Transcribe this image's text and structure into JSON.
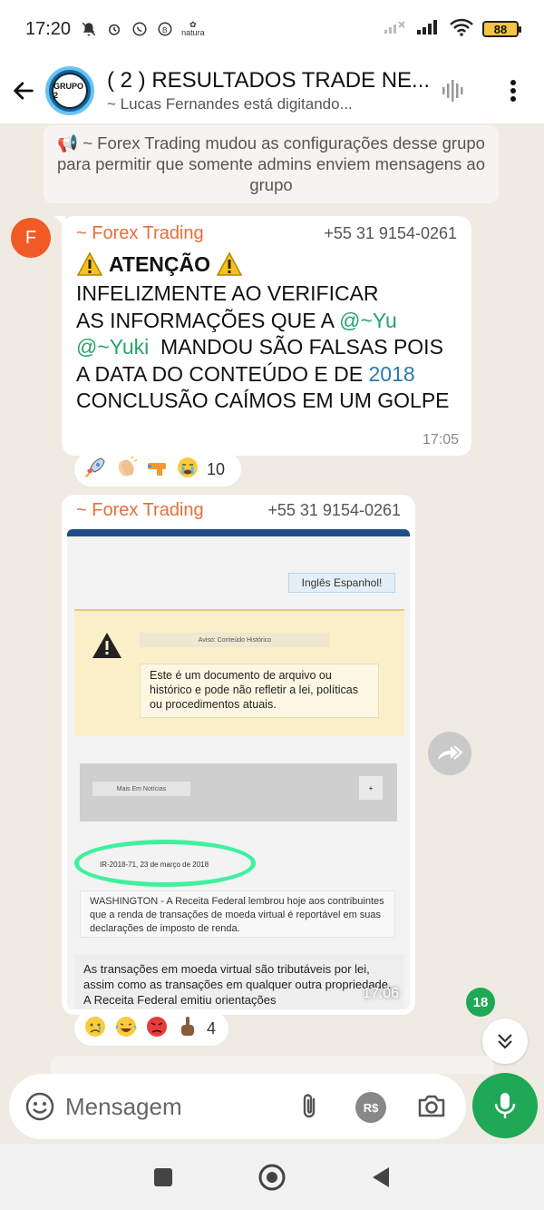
{
  "status_bar": {
    "time": "17:20",
    "natura_label": "natura",
    "battery": "88"
  },
  "header": {
    "avatar_label": "GRUPO 2",
    "title": "( 2 ) RESULTADOS TRADE NE...",
    "subtitle": "~ Lucas Fernandes está digitando..."
  },
  "system_message": "📢 ~ Forex Trading mudou as configurações desse grupo para permitir que somente admins enviem mensagens ao grupo",
  "message1": {
    "avatar_letter": "F",
    "sender": "~ Forex Trading",
    "phone": "+55 31 9154-0261",
    "heading": "ATENÇÃO",
    "line1": "INFELIZMENTE AO VERIFICAR",
    "line2_pre": "AS INFORMAÇÕES QUE A ",
    "mention1": "@~Yu",
    "mention2": "@~Yuki",
    "line3_post": "  MANDOU SÃO FALSAS POIS",
    "line4_pre": "A DATA DO CONTEÚDO E DE ",
    "year": "2018",
    "line5": "CONCLUSÃO CAÍMOS EM UM GOLPE",
    "time": "17:05",
    "reaction_count": "10"
  },
  "message2": {
    "sender": "~ Forex Trading",
    "phone": "+55 31 9154-0261",
    "time": "17:06",
    "reaction_count": "4",
    "image": {
      "lang_button": "Inglês Espanhol!",
      "notice_label": "Aviso: Conteúdo Histórico",
      "notice_text": "Este é um documento de arquivo ou histórico e pode não refletir a lei, políticas ou procedimentos atuais.",
      "more_news": "Mais Em Notícias",
      "plus": "+",
      "date_ref": "IR-2018-71, 23 de março de 2018",
      "washington": "WASHINGTON - A Receita Federal lembrou hoje aos contribuintes que a renda de transações de moeda virtual é reportável em suas declarações de imposto de renda.",
      "tax_text": "As transações em moeda virtual são tributáveis por lei, assim como as transações em qualquer outra propriedade. A Receita Federal emitiu orientações"
    }
  },
  "unread_count": "18",
  "input": {
    "placeholder": "Mensagem",
    "rs_label": "R$"
  },
  "colors": {
    "accent_green": "#1fa855",
    "sender_orange": "#e76f3a",
    "mention_green": "#27a36a",
    "link_blue": "#2a7ab7",
    "chat_bg": "#efeae2"
  }
}
